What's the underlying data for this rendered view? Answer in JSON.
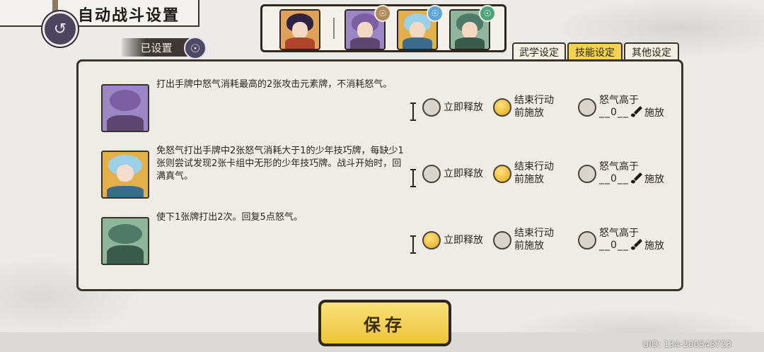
{
  "header": {
    "title": "自动战斗设置",
    "set_badge": "已设置"
  },
  "portraits": [
    {
      "name": "leader",
      "hair": "#2d2344",
      "body": "#b0452c",
      "bg": "#e0a25a",
      "element": null
    },
    {
      "name": "purple-dragon",
      "hair": "#7b5fa2",
      "body": "#5d4672",
      "bg": "#9d86c4",
      "element": "#b08a5a"
    },
    {
      "name": "blue-hair-youth",
      "hair": "#9ad0e8",
      "body": "#3b6c8e",
      "bg": "#e3b04a",
      "element": "#5aa6d8"
    },
    {
      "name": "green-beast",
      "hair": "#4f7a68",
      "body": "#3a5a4c",
      "bg": "#8fb59a",
      "element": "#4fa37a"
    }
  ],
  "tabs": [
    {
      "label": "武学设定",
      "active": false
    },
    {
      "label": "技能设定",
      "active": true
    },
    {
      "label": "其他设定",
      "active": false
    }
  ],
  "rows": [
    {
      "desc": "打出手牌中怒气消耗最高的2张攻击元素牌，不消耗怒气。",
      "card": {
        "hair": "#7b5fa2",
        "body": "#5d4672",
        "bg": "#9d86c4"
      },
      "selected": 1
    },
    {
      "desc": "免怒气打出手牌中2张怒气消耗大于1的少年技巧牌，每缺少1张则尝试发现2张卡组中无形的少年技巧牌。战斗开始时，回满真气。",
      "card": {
        "hair": "#9ad0e8",
        "body": "#3b6c8e",
        "bg": "#e3b04a"
      },
      "selected": 1
    },
    {
      "desc": "使下1张牌打出2次。回复5点怒气。",
      "card": {
        "hair": "#4f7a68",
        "body": "#3a5a4c",
        "bg": "#8fb59a"
      },
      "selected": 0
    }
  ],
  "options": {
    "immediate": "立即释放",
    "end_line1": "结束行动",
    "end_line2": "前施放",
    "anger_line1": "怒气高于",
    "anger_blank": "__0__",
    "anger_cast": "施放"
  },
  "save_label": "保存",
  "uid": "UID:  134-200543723",
  "colors": {
    "accent": "#f5d24f",
    "ink": "#3a332c",
    "radio_on": "#e0a81e"
  }
}
